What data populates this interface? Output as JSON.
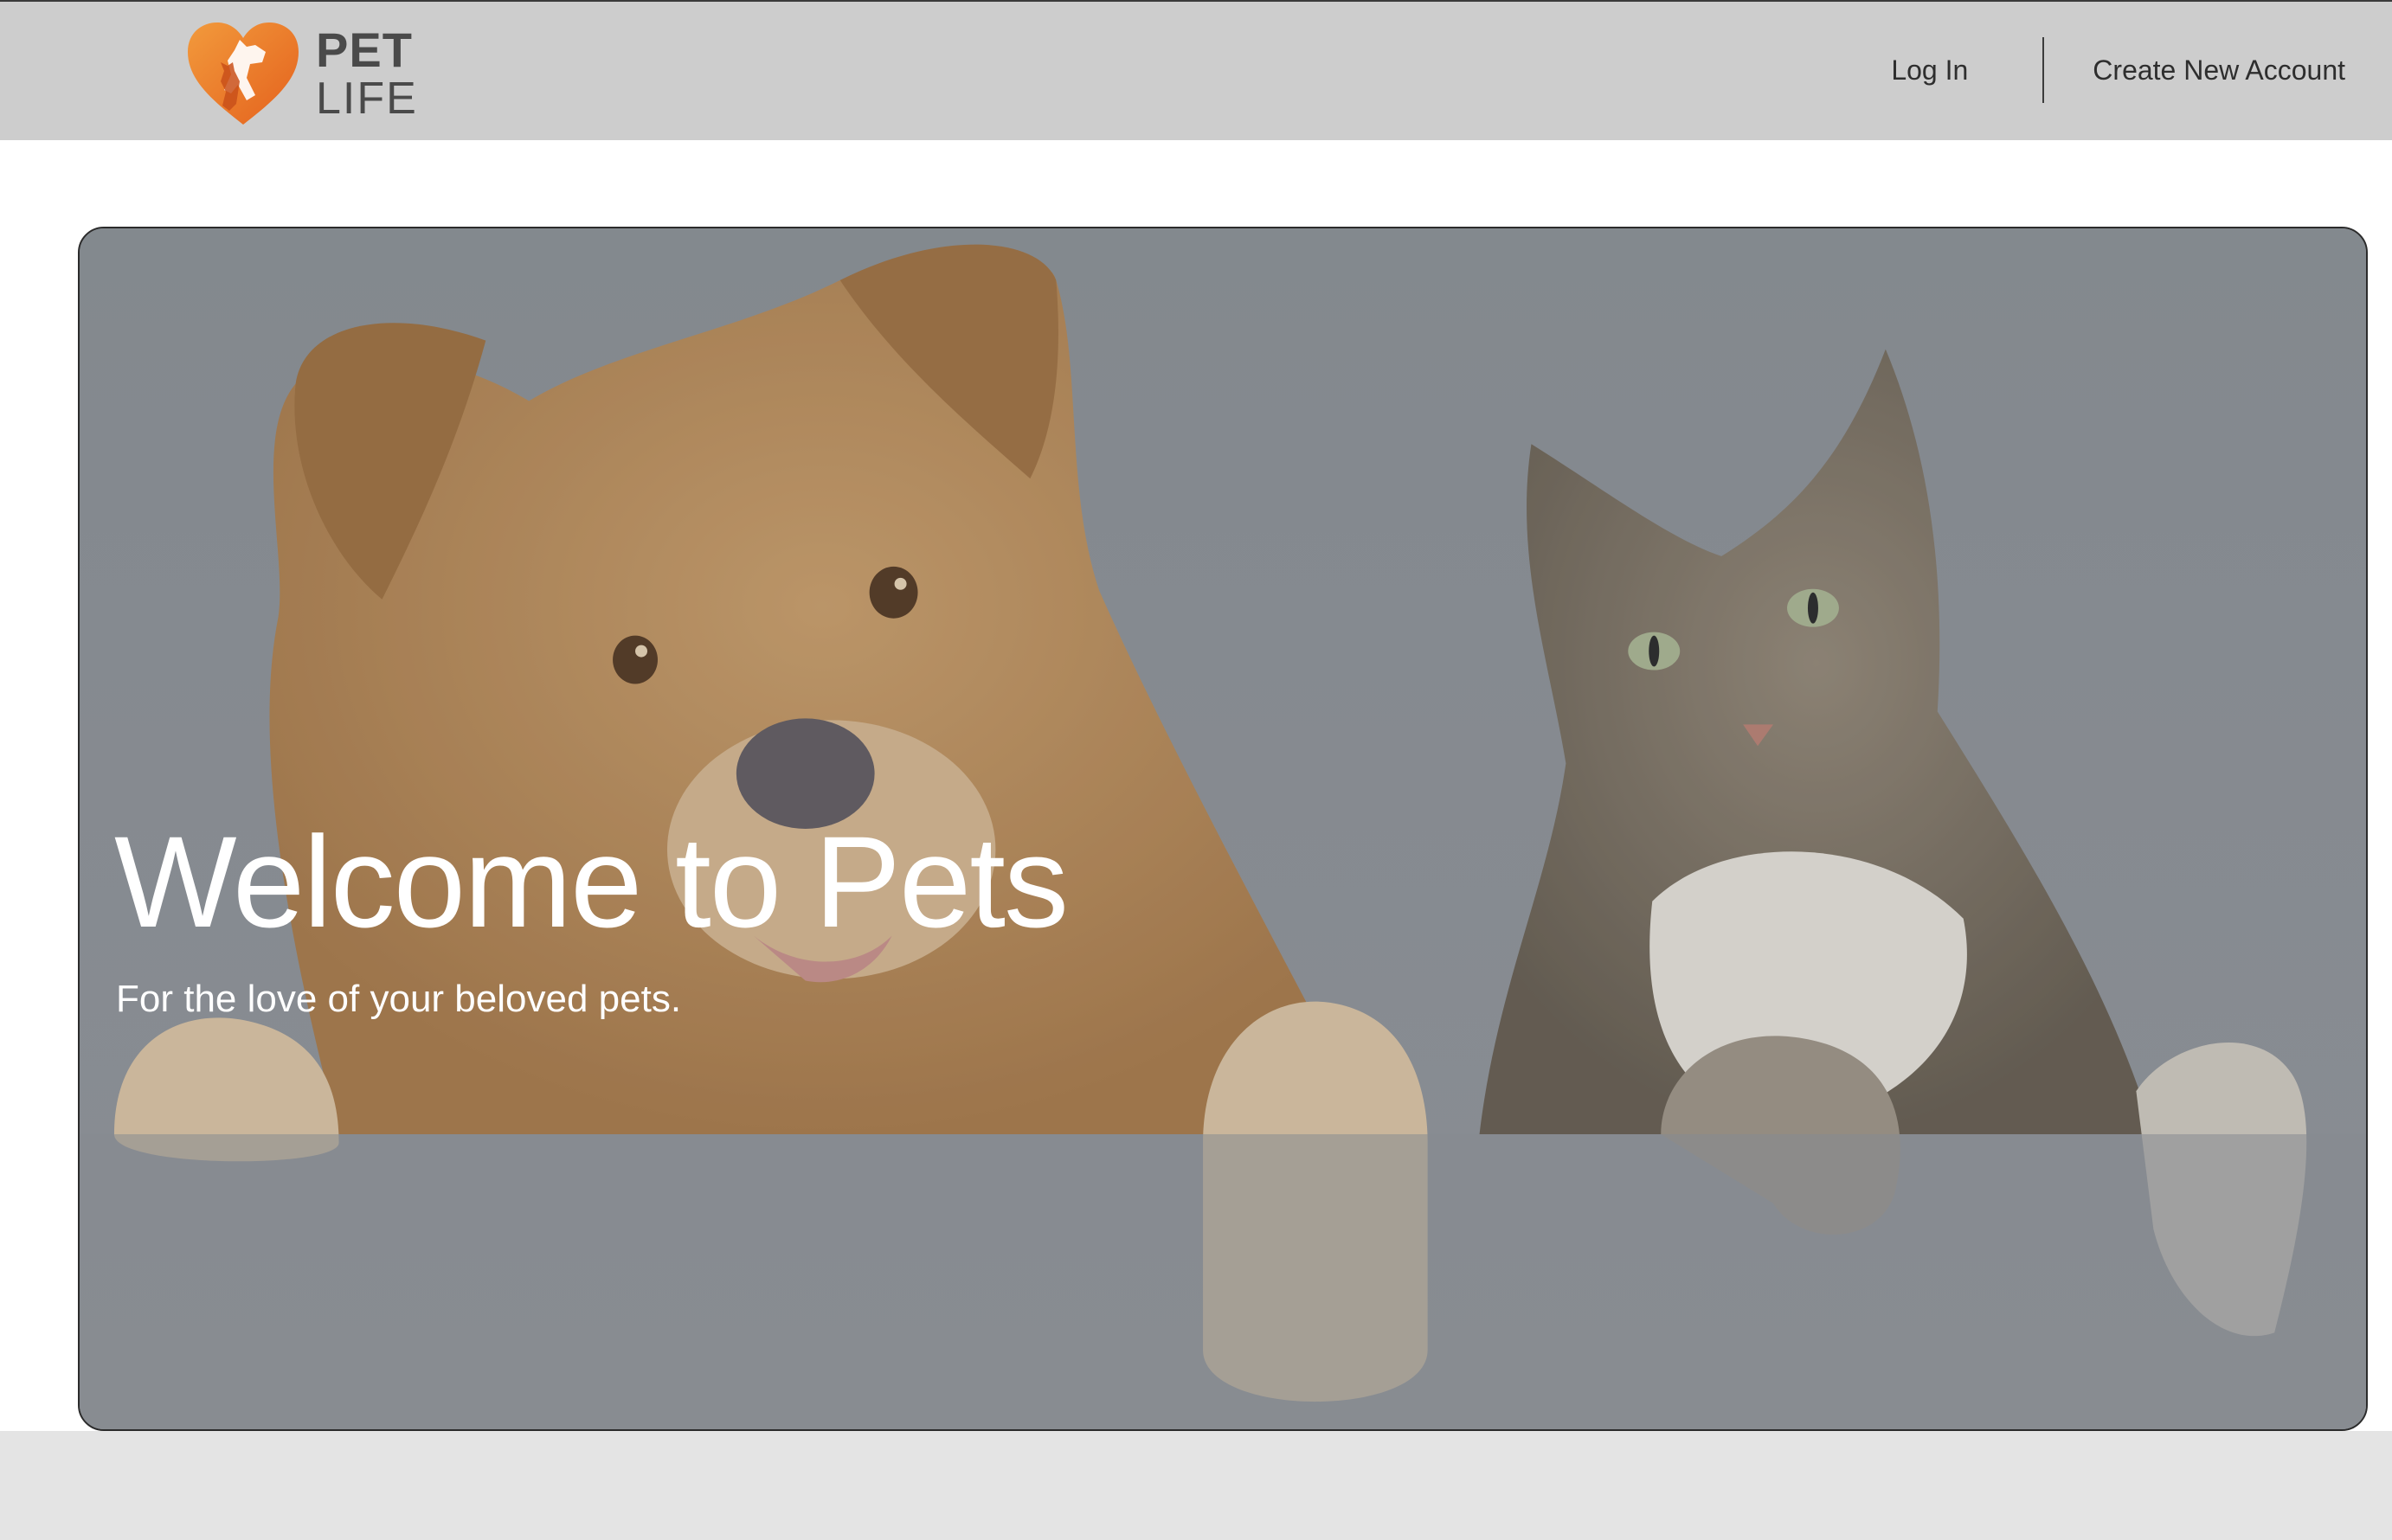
{
  "header": {
    "logo": {
      "line1": "PET",
      "line2": "LIFE",
      "icon": "heart-pet-logo-icon",
      "accent_color": "#ee7b28"
    },
    "nav": {
      "login_label": "Log In",
      "create_account_label": "Create New Account"
    },
    "background_color": "#cdcdcd"
  },
  "hero": {
    "title": "Welcome to Pets",
    "subtitle": "For the love of your beloved pets.",
    "image": "dog-and-cat-photo",
    "overlay_color": "#8a8e93"
  },
  "footer": {
    "background_color": "#e4e4e4"
  }
}
